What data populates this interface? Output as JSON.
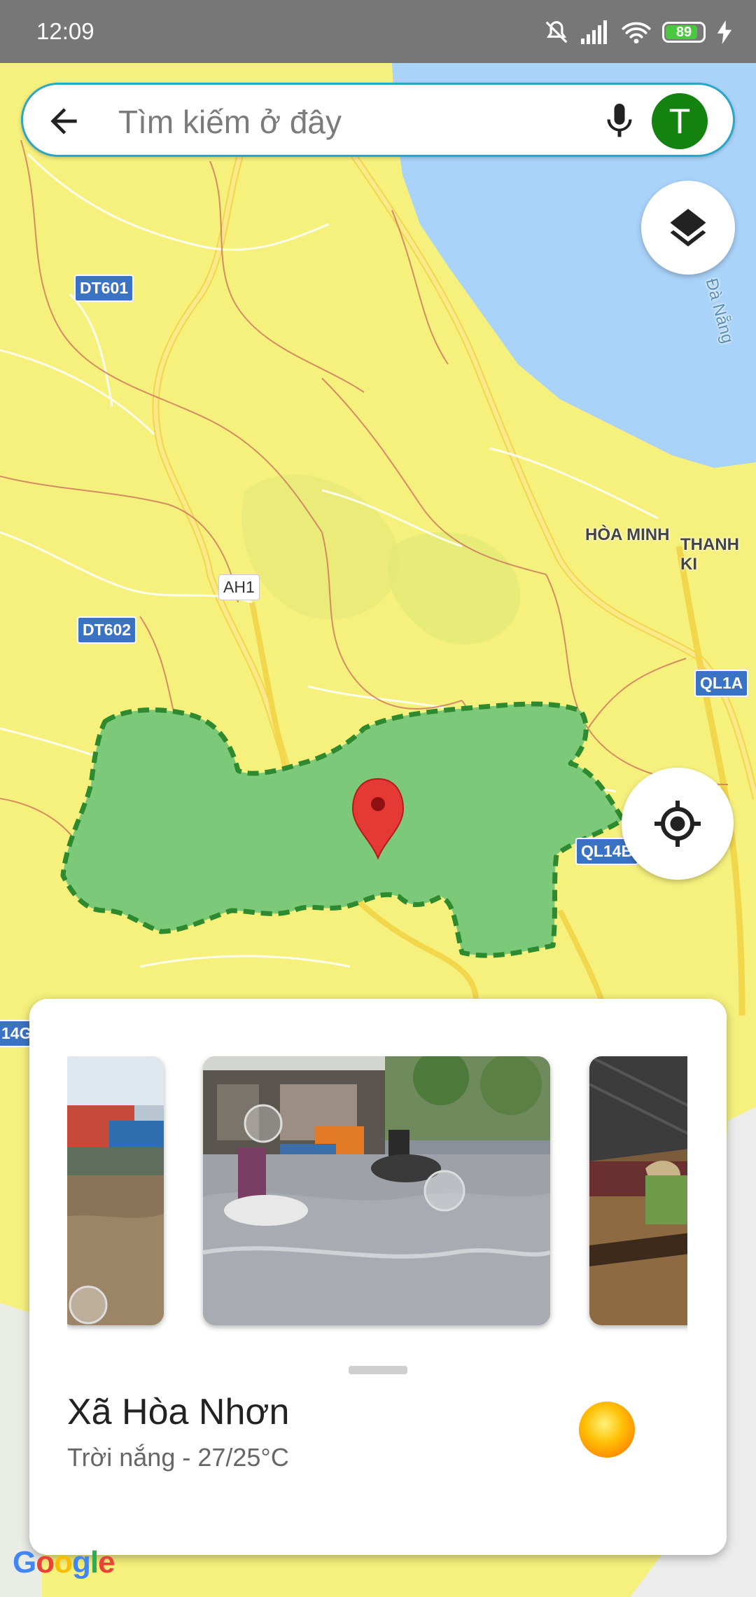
{
  "status": {
    "time": "12:09",
    "battery_level": "89"
  },
  "search": {
    "placeholder": "Tìm kiếm ở đây",
    "avatar_letter": "T"
  },
  "map": {
    "road_labels": [
      "DT601",
      "DT602",
      "AH1",
      "QL1A",
      "QL14B",
      "14G"
    ],
    "place_labels": [
      "HÒA MINH",
      "THANH KI",
      "Đà Nẵng"
    ]
  },
  "place": {
    "name": "Xã Hòa Nhơn",
    "weather": "Trời nắng - 27/25°C"
  },
  "brand": {
    "google_letters": [
      "G",
      "o",
      "o",
      "g",
      "l",
      "e"
    ]
  },
  "colors": {
    "accent": "#2aa6c8",
    "avatar": "#13820f",
    "polygon": "#7dc97a",
    "polygon_border": "#2e8a2e",
    "pin": "#e53935",
    "land": "#f5f07a",
    "water": "#aad3fa"
  }
}
